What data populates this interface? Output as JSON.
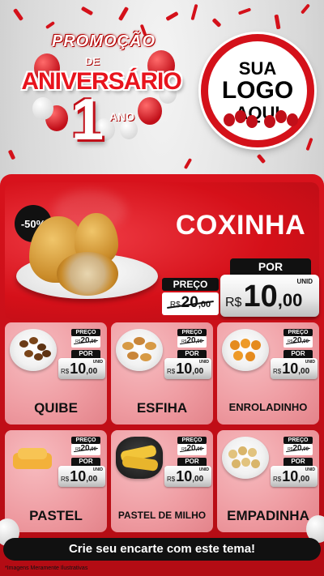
{
  "header": {
    "promo_title": "PROMOÇÃO",
    "promo_de": "DE",
    "promo_aniversario": "ANIVERSÁRIO",
    "promo_number": "1",
    "promo_ano": "ANO",
    "logo_line1": "SUA",
    "logo_line2": "LOGO",
    "logo_line3": "AQUI"
  },
  "featured": {
    "discount": "-50%",
    "name": "COXINHA",
    "preco_label": "PREÇO",
    "old_currency": "R$",
    "old_int": "20",
    "old_cents": ",00",
    "por_label": "POR",
    "new_currency": "R$",
    "new_int": "10",
    "new_cents": ",00",
    "unit": "UNID"
  },
  "products": [
    {
      "name": "QUIBE",
      "preco_label": "PREÇO",
      "old_currency": "R$",
      "old_int": "20",
      "old_cents": ",00",
      "por_label": "POR",
      "new_currency": "R$",
      "new_int": "10",
      "new_cents": ",00",
      "unit": "UNID"
    },
    {
      "name": "ESFIHA",
      "preco_label": "PREÇO",
      "old_currency": "R$",
      "old_int": "20",
      "old_cents": ",00",
      "por_label": "POR",
      "new_currency": "R$",
      "new_int": "10",
      "new_cents": ",00",
      "unit": "UNID"
    },
    {
      "name": "ENROLADINHO",
      "preco_label": "PREÇO",
      "old_currency": "R$",
      "old_int": "20",
      "old_cents": ",00",
      "por_label": "POR",
      "new_currency": "R$",
      "new_int": "10",
      "new_cents": ",00",
      "unit": "UNID"
    },
    {
      "name": "PASTEL",
      "preco_label": "PREÇO",
      "old_currency": "R$",
      "old_int": "20",
      "old_cents": ",00",
      "por_label": "POR",
      "new_currency": "R$",
      "new_int": "10",
      "new_cents": ",00",
      "unit": "UNID"
    },
    {
      "name": "PASTEL DE MILHO",
      "preco_label": "PREÇO",
      "old_currency": "R$",
      "old_int": "20",
      "old_cents": ",00",
      "por_label": "POR",
      "new_currency": "R$",
      "new_int": "10",
      "new_cents": ",00",
      "unit": "UNID"
    },
    {
      "name": "EMPADINHA",
      "preco_label": "PREÇO",
      "old_currency": "R$",
      "old_int": "20",
      "old_cents": ",00",
      "por_label": "POR",
      "new_currency": "R$",
      "new_int": "10",
      "new_cents": ",00",
      "unit": "UNID"
    }
  ],
  "footer": {
    "cta": "Crie seu encarte com este tema!",
    "disclaimer": "*Imagens Meramente Ilustrativas"
  },
  "colors": {
    "brand_red": "#d4111a",
    "card_pink": "#ee9aa0",
    "dark": "#111111"
  }
}
